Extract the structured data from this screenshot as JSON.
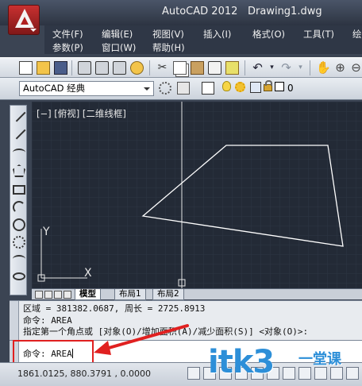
{
  "window": {
    "app_title": "AutoCAD 2012",
    "document": "Drawing1.dwg"
  },
  "menu": {
    "items": [
      "文件(F)",
      "编辑(E)",
      "视图(V)",
      "插入(I)",
      "格式(O)",
      "工具(T)",
      "绘",
      "参数(P)",
      "窗口(W)",
      "帮助(H)"
    ]
  },
  "workspace": {
    "name": "AutoCAD 经典",
    "layer": "0"
  },
  "viewport": {
    "label": "[−] [俯视] [二维线框]",
    "ucs_x": "X",
    "ucs_y": "Y"
  },
  "tabs": [
    "模型",
    "布局1",
    "布局2"
  ],
  "command_history": [
    "区域 = 381382.0687, 周长 = 2725.8913",
    "命令: AREA",
    "指定第一个角点或 [对象(O)/增加面积(A)/减少面积(S)] <对象(O)>:"
  ],
  "command_input": {
    "text": "命令: AREA"
  },
  "status": {
    "coords": "1861.0125, 880.3791 , 0.0000"
  },
  "watermark": {
    "main": "itk3",
    "sub": "一堂课"
  },
  "colors": {
    "canvas": "#232a36",
    "highlight": "#e02020",
    "watermark": "#2d8fd8"
  }
}
